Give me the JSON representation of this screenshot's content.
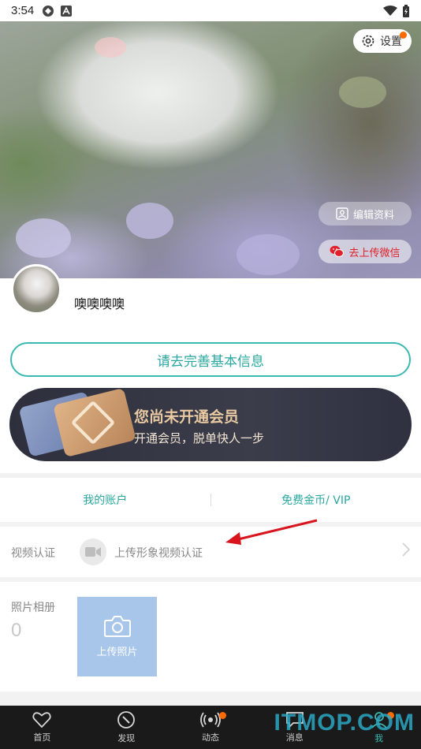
{
  "status_bar": {
    "time": "3:54"
  },
  "hero": {
    "settings_label": "设置",
    "edit_label": "编辑资料",
    "wechat_label": "去上传微信"
  },
  "profile": {
    "nickname": "噢噢噢噢",
    "complete_info_label": "请去完善基本信息",
    "vip_title": "您尚未开通会员",
    "vip_subtitle": "开通会员，脱单快人一步"
  },
  "account": {
    "my_account_label": "我的账户",
    "free_coins_label": "免费金币/ VIP"
  },
  "video_auth": {
    "label": "视频认证",
    "upload_text": "上传形象视频认证"
  },
  "photos": {
    "label": "照片相册",
    "count": "0",
    "upload_label": "上传照片"
  },
  "nav": {
    "items": [
      {
        "label": "首页",
        "icon": "heart-icon"
      },
      {
        "label": "发现",
        "icon": "compass-icon"
      },
      {
        "label": "动态",
        "icon": "broadcast-icon"
      },
      {
        "label": "消息",
        "icon": "message-icon"
      },
      {
        "label": "我",
        "icon": "user-icon"
      }
    ]
  },
  "watermark": "ITMOP.COM",
  "colors": {
    "accent": "#3bb8b0",
    "badge": "#ff6a00",
    "wechat_red": "#e0202a",
    "nav_bg": "#1a1a1a"
  }
}
